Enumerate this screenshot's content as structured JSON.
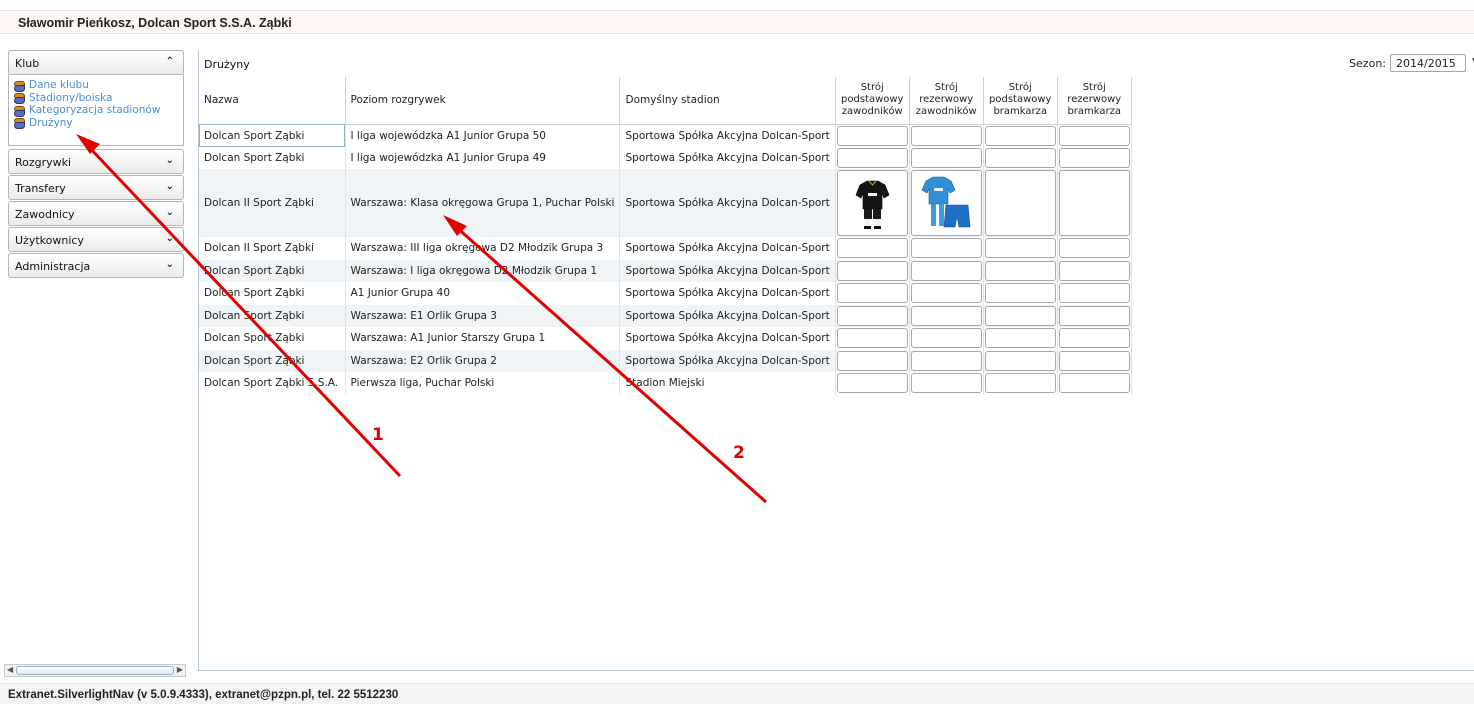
{
  "header": {
    "title": "Sławomir Pieńkosz, Dolcan Sport S.S.A. Ząbki"
  },
  "sidebar": {
    "sections": [
      {
        "label": "Klub",
        "expanded": true
      },
      {
        "label": "Rozgrywki",
        "expanded": false
      },
      {
        "label": "Transfery",
        "expanded": false
      },
      {
        "label": "Zawodnicy",
        "expanded": false
      },
      {
        "label": "Użytkownicy",
        "expanded": false
      },
      {
        "label": "Administracja",
        "expanded": false
      }
    ],
    "klub_items": [
      "Dane klubu",
      "Stadiony/boiska",
      "Kategoryzacja stadionów",
      "Drużyny"
    ]
  },
  "main": {
    "section_title": "Drużyny",
    "season_label": "Sezon:",
    "season_value": "2014/2015",
    "columns": [
      "Nazwa",
      "Poziom rozgrywek",
      "Domyślny stadion",
      "Strój podstawowy zawodników",
      "Strój rezerwowy zawodników",
      "Strój podstawowy bramkarza",
      "Strój rezerwowy bramkarza"
    ],
    "rows": [
      {
        "nazwa": "Dolcan Sport Ząbki",
        "poziom": "I liga wojewódzka A1 Junior Grupa 50",
        "stadion": "Sportowa Spółka Akcyjna Dolcan-Sport"
      },
      {
        "nazwa": "Dolcan Sport Ząbki",
        "poziom": "I liga wojewódzka A1 Junior Grupa 49",
        "stadion": "Sportowa Spółka Akcyjna Dolcan-Sport"
      },
      {
        "nazwa": "Dolcan II Sport Ząbki",
        "poziom": "Warszawa: Klasa okręgowa Grupa 1, Puchar Polski",
        "stadion": "Sportowa Spółka Akcyjna Dolcan-Sport"
      },
      {
        "nazwa": "Dolcan II Sport Ząbki",
        "poziom": "Warszawa: III liga okręgowa D2 Młodzik Grupa 3",
        "stadion": "Sportowa Spółka Akcyjna Dolcan-Sport"
      },
      {
        "nazwa": "Dolcan Sport Ząbki",
        "poziom": "Warszawa: I liga okręgowa D2 Młodzik Grupa 1",
        "stadion": "Sportowa Spółka Akcyjna Dolcan-Sport"
      },
      {
        "nazwa": "Dolcan Sport Ząbki",
        "poziom": "A1 Junior Grupa 40",
        "stadion": "Sportowa Spółka Akcyjna Dolcan-Sport"
      },
      {
        "nazwa": "Dolcan Sport Ząbki",
        "poziom": "Warszawa: E1 Orlik Grupa 3",
        "stadion": "Sportowa Spółka Akcyjna Dolcan-Sport"
      },
      {
        "nazwa": "Dolcan Sport Ząbki",
        "poziom": "Warszawa: A1 Junior Starszy Grupa 1",
        "stadion": "Sportowa Spółka Akcyjna Dolcan-Sport"
      },
      {
        "nazwa": "Dolcan Sport Ząbki",
        "poziom": "Warszawa: E2 Orlik Grupa 2",
        "stadion": "Sportowa Spółka Akcyjna Dolcan-Sport"
      },
      {
        "nazwa": "Dolcan Sport Ząbki S.S.A.",
        "poziom": "Pierwsza liga, Puchar Polski",
        "stadion": "Stadion Miejski"
      }
    ]
  },
  "annotations": {
    "arrow1": "1",
    "arrow2": "2",
    "color": "#e00000"
  },
  "footer": {
    "text": "Extranet.SilverlightNav (v 5.0.9.4333), extranet@pzpn.pl, tel. 22 5512230"
  }
}
